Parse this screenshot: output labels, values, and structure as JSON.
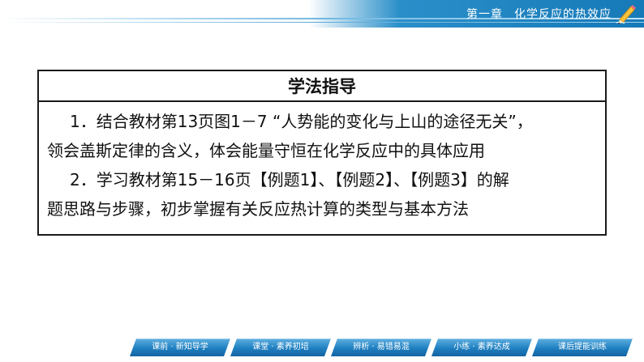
{
  "header": {
    "chapter": "第一章",
    "title": "化学反应的热效应",
    "icon": "pencil-icon"
  },
  "guide": {
    "title": "学法指导",
    "line1": "1．结合教材第13页图1－7 “人势能的变化与上山的途径无关”，",
    "line2": "领会盖斯定律的含义，体会能量守恒在化学反应中的具体应用",
    "line3": "2．学习教材第15－16页【例题1】、【例题2】、【例题3】的解",
    "line4": "题思路与步骤，初步掌握有关反应热计算的类型与基本方法"
  },
  "nav": {
    "items": [
      {
        "label": "课前 · 新知导学"
      },
      {
        "label": "课堂 · 素养初培"
      },
      {
        "label": "辨析 · 易错易混"
      },
      {
        "label": "小练 · 素养达成"
      },
      {
        "label": "课后提能训练"
      }
    ]
  },
  "colors": {
    "header_blue": "#1679b8",
    "nav_blue": "#1f7fc0",
    "border": "#1a1a1a"
  }
}
